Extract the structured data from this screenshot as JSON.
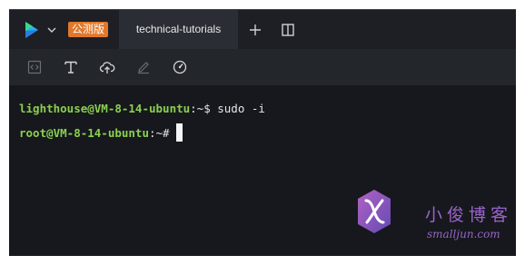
{
  "titlebar": {
    "badge": "公测版",
    "tab_label": "technical-tutorials",
    "icons": [
      "app-logo-icon",
      "chevron-down-icon",
      "plus-icon",
      "split-view-icon"
    ]
  },
  "toolbar": {
    "icons": [
      "code-icon",
      "text-format-icon",
      "cloud-upload-icon",
      "edit-icon",
      "gauge-icon"
    ]
  },
  "terminal": {
    "line1_prompt": "lighthouse@VM-8-14-ubuntu",
    "line1_sep": ":~$",
    "line1_cmd": " sudo -i",
    "line2_prompt": "root@VM-8-14-ubuntu",
    "line2_sep": ":~#"
  },
  "watermark": {
    "text": "小俊博客",
    "url": "smalljun.com"
  },
  "colors": {
    "prompt_green": "#8bd04e",
    "badge_orange": "#e1782a",
    "terminal_bg": "#16181d",
    "watermark_purple": "#9a63c9"
  }
}
